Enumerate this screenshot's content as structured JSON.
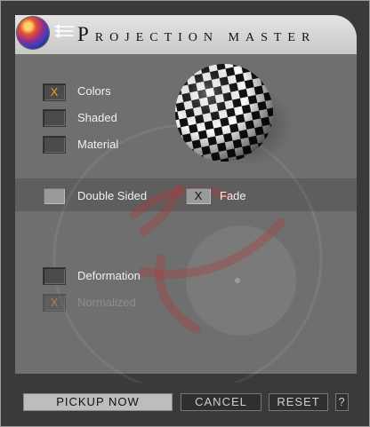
{
  "header": {
    "title": "Projection Master"
  },
  "options": {
    "colors": {
      "label": "Colors",
      "mark": "X"
    },
    "shaded": {
      "label": "Shaded",
      "mark": ""
    },
    "material": {
      "label": "Material",
      "mark": ""
    },
    "double_sided": {
      "label": "Double Sided",
      "mark": ""
    },
    "fade": {
      "label": "Fade",
      "mark": "X"
    },
    "deformation": {
      "label": "Deformation",
      "mark": ""
    },
    "normalized": {
      "label": "Normalized",
      "mark": "X"
    }
  },
  "buttons": {
    "pickup": "PICKUP NOW",
    "cancel": "CANCEL",
    "reset": "RESET",
    "help": "?"
  },
  "colors": {
    "accent": "#f39a2b",
    "watermark": "#b03a3a"
  },
  "icons": {
    "logo": "sphere-logo-icon",
    "preview": "checkered-sphere-icon"
  }
}
